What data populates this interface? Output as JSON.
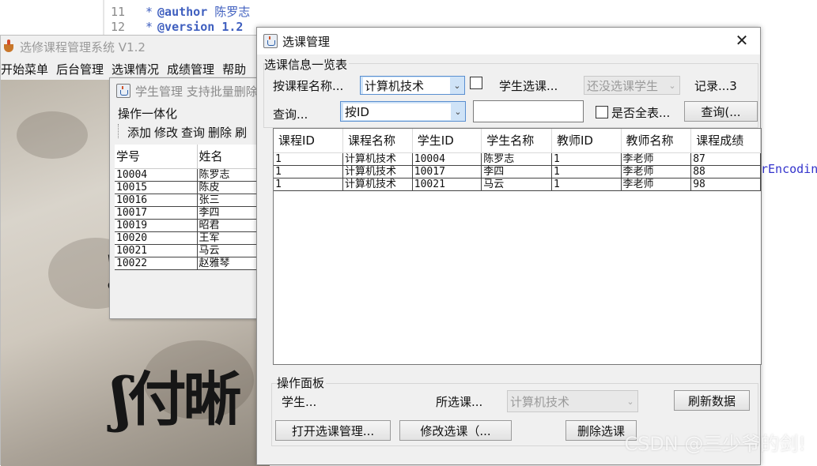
{
  "editor": {
    "lines": [
      {
        "num": "11",
        "tag": "@author",
        "text": "陈罗志"
      },
      {
        "num": "12",
        "tag": "@version",
        "text": "1.2"
      }
    ],
    "tail_text": "rEncoding"
  },
  "main_window": {
    "title": "选修课程管理系统 V1.2",
    "menu": [
      "开始菜单",
      "后台管理",
      "选课情况",
      "成绩管理",
      "帮助"
    ]
  },
  "student_frame": {
    "title": "学生管理  支持批量删除",
    "group_label": "操作一体化",
    "toolbar": [
      "添加",
      "修改",
      "查询",
      "删除",
      "刷"
    ],
    "columns": [
      "学号",
      "姓名"
    ],
    "rows": [
      [
        "10004",
        "陈罗志"
      ],
      [
        "10015",
        "陈皮"
      ],
      [
        "10016",
        "张三"
      ],
      [
        "10017",
        "李四"
      ],
      [
        "10019",
        "昭君"
      ],
      [
        "10020",
        "王军"
      ],
      [
        "10021",
        "马云"
      ],
      [
        "10022",
        "赵雅琴"
      ]
    ]
  },
  "dialog": {
    "title": "选课管理",
    "close_glyph": "✕",
    "info_group": "选课信息一览表",
    "by_course_label": "按课程名称...",
    "course_combo_value": "计算机技术",
    "student_select_label": "学生选课...",
    "student_combo_value": "还没选课学生",
    "record_label": "记录...3",
    "query_label": "查询...",
    "query_combo_value": "按ID",
    "query_text": "",
    "full_table_label": "是否全表...",
    "query_button": "查询(...",
    "table": {
      "columns": [
        "课程ID",
        "课程名称",
        "学生ID",
        "学生名称",
        "教师ID",
        "教师名称",
        "课程成绩"
      ],
      "rows": [
        [
          "1",
          "计算机技术",
          "10004",
          "陈罗志",
          "1",
          "李老师",
          "87"
        ],
        [
          "1",
          "计算机技术",
          "10017",
          "李四",
          "1",
          "李老师",
          "88"
        ],
        [
          "1",
          "计算机技术",
          "10021",
          "马云",
          "1",
          "李老师",
          "98"
        ]
      ]
    },
    "panel_group": "操作面板",
    "student_label": "学生...",
    "selected_course_label": "所选课...",
    "selected_course_value": "计算机技术",
    "refresh_button": "刷新数据",
    "open_button": "打开选课管理...",
    "modify_button": "修改选课（...",
    "delete_button": "删除选课"
  },
  "watermark": "CSDN @三少爷的剑!",
  "colors": {
    "window_bg": "#f0f0f0",
    "focused_combo": "#cfe3f7",
    "code_keyword": "#3f5fbf"
  }
}
